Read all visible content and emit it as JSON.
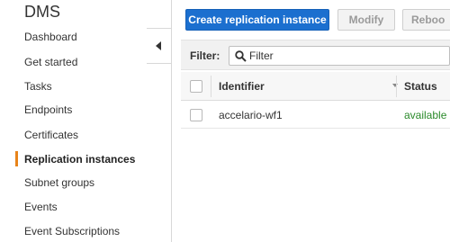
{
  "sidebar": {
    "title": "DMS",
    "items": [
      {
        "label": "Dashboard"
      },
      {
        "label": "Get started"
      },
      {
        "label": "Tasks"
      },
      {
        "label": "Endpoints"
      },
      {
        "label": "Certificates"
      },
      {
        "label": "Replication instances"
      },
      {
        "label": "Subnet groups"
      },
      {
        "label": "Events"
      },
      {
        "label": "Event Subscriptions"
      }
    ],
    "active_index": 5
  },
  "toolbar": {
    "create_label": "Create replication instance",
    "modify_label": "Modify",
    "reboot_label": "Reboo"
  },
  "filter": {
    "label": "Filter:",
    "placeholder": "Filter",
    "value": ""
  },
  "table": {
    "columns": [
      "Identifier",
      "Status"
    ],
    "rows": [
      {
        "identifier": "accelario-wf1",
        "status": "available"
      }
    ]
  },
  "colors": {
    "primary": "#1b6fcf",
    "active_accent": "#e8841a",
    "status_available": "#2a8a2a"
  },
  "icons": {
    "collapse": "triangle-left-icon",
    "search": "search-icon",
    "sort": "sort-down-icon"
  }
}
